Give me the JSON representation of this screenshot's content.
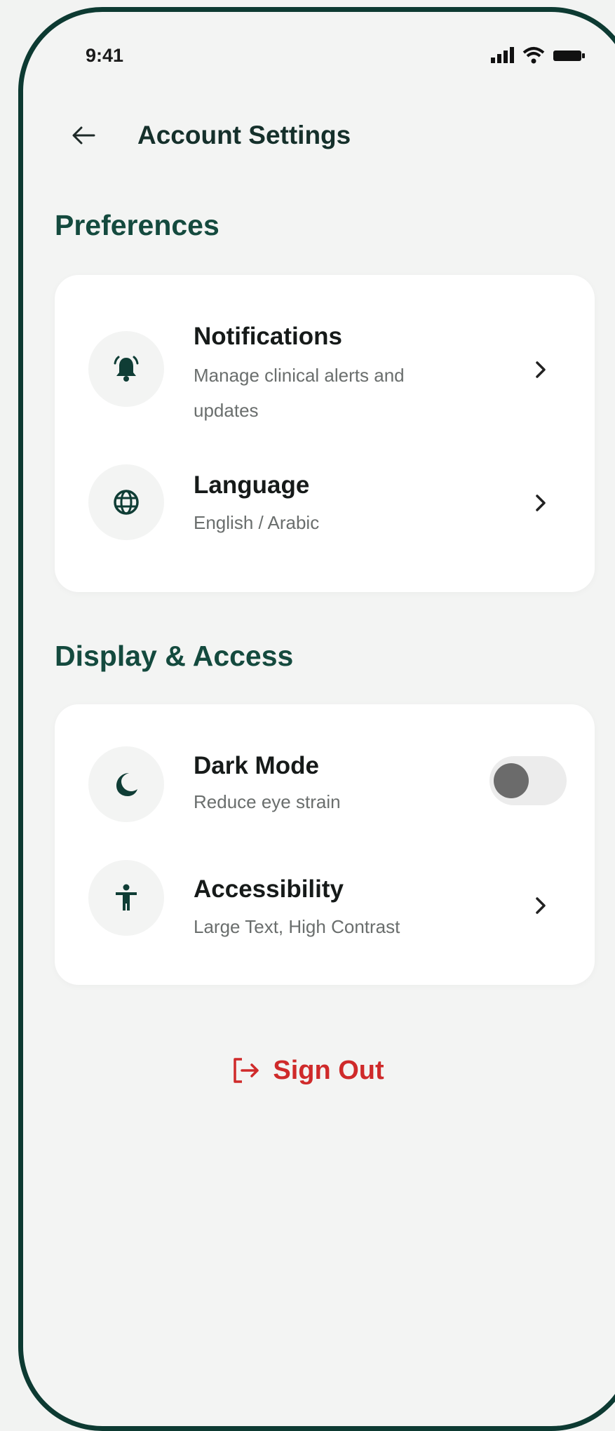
{
  "status_bar": {
    "time": "9:41"
  },
  "header": {
    "title": "Account Settings"
  },
  "sections": [
    {
      "title": "Preferences",
      "items": [
        {
          "title": "Notifications",
          "subtitle_line1": "Manage clinical alerts and",
          "subtitle_line2": "updates",
          "icon": "bell-icon",
          "control": "chevron"
        },
        {
          "title": "Language",
          "subtitle_line1": "English / Arabic",
          "icon": "globe-icon",
          "control": "chevron"
        }
      ]
    },
    {
      "title": "Display & Access",
      "items": [
        {
          "title": "Dark Mode",
          "subtitle_line1": "Reduce eye strain",
          "icon": "moon-icon",
          "control": "toggle",
          "toggle_on": false
        },
        {
          "title": "Accessibility",
          "subtitle_line1": "Large Text, High Contrast",
          "icon": "accessibility-icon",
          "control": "chevron"
        }
      ]
    }
  ],
  "sign_out": {
    "label": "Sign Out",
    "icon": "sign-out-icon"
  },
  "colors": {
    "frame": "#0d3a32",
    "section_title": "#144a3e",
    "icon": "#0f3d35",
    "sign_out": "#cf2a2a",
    "background": "#f3f4f3",
    "card": "#ffffff"
  }
}
